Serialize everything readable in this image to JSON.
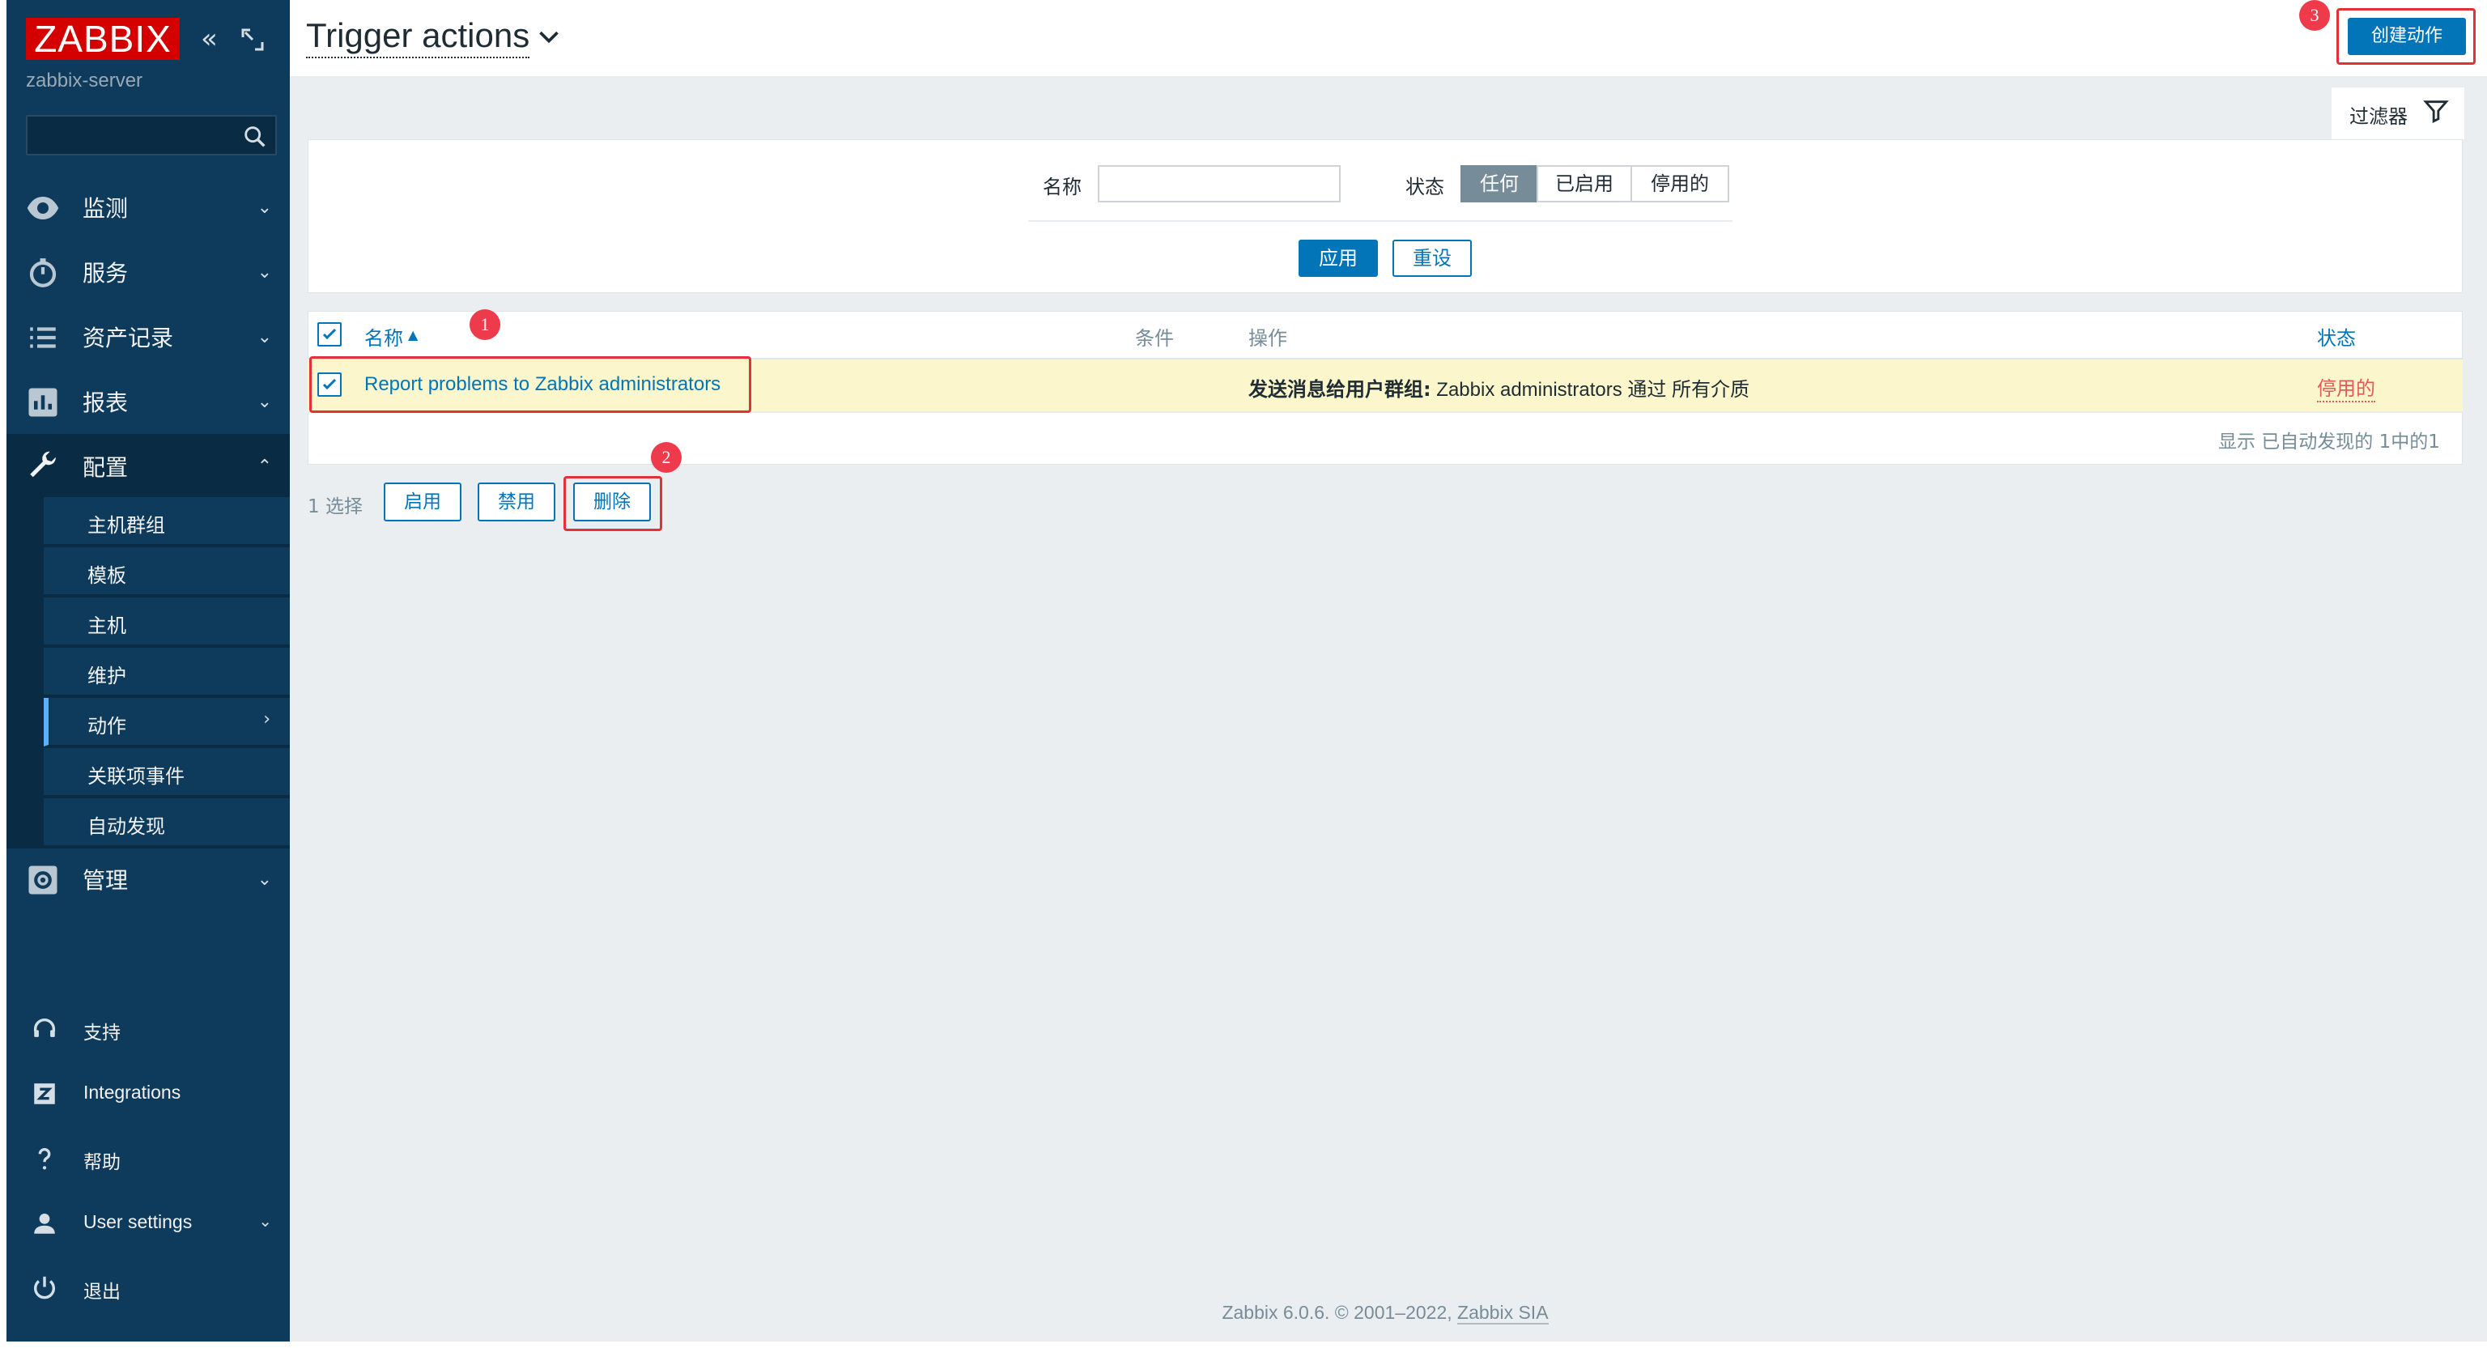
{
  "sidebar": {
    "logo": "ZABBIX",
    "server_name": "zabbix-server",
    "search_placeholder": "",
    "menu": [
      {
        "label": "监测",
        "icon": "eye-icon"
      },
      {
        "label": "服务",
        "icon": "stopwatch-icon"
      },
      {
        "label": "资产记录",
        "icon": "list-icon"
      },
      {
        "label": "报表",
        "icon": "bar-chart-icon"
      },
      {
        "label": "配置",
        "icon": "wrench-icon"
      },
      {
        "label": "管理",
        "icon": "gear-icon"
      }
    ],
    "config_submenu": [
      "主机群组",
      "模板",
      "主机",
      "维护",
      "动作",
      "关联项事件",
      "自动发现"
    ],
    "bottom": [
      {
        "label": "支持",
        "icon": "headset-icon"
      },
      {
        "label": "Integrations",
        "icon": "z-icon"
      },
      {
        "label": "帮助",
        "icon": "question-icon"
      },
      {
        "label": "User settings",
        "icon": "user-icon"
      },
      {
        "label": "退出",
        "icon": "power-icon"
      }
    ]
  },
  "header": {
    "title": "Trigger actions",
    "create_button": "创建动作"
  },
  "filter": {
    "tab_label": "过滤器",
    "name_label": "名称",
    "name_value": "",
    "status_label": "状态",
    "status_options": [
      "任何",
      "已启用",
      "停用的"
    ],
    "status_selected": "任何",
    "apply_button": "应用",
    "reset_button": "重设"
  },
  "table": {
    "columns": [
      "名称",
      "条件",
      "操作",
      "状态"
    ],
    "sort_indicator": "▲",
    "rows": [
      {
        "name": "Report problems to Zabbix administrators",
        "conditions": "",
        "operation_prefix": "发送消息给用户群组:",
        "operation_text": " Zabbix administrators 通过 所有介质",
        "status": "停用的",
        "checked": true
      }
    ],
    "stats": "显示 已自动发现的 1中的1"
  },
  "mass_actions": {
    "selected_count": "1 选择",
    "enable_button": "启用",
    "disable_button": "禁用",
    "delete_button": "删除"
  },
  "annotations": [
    "1",
    "2",
    "3"
  ],
  "footer": {
    "text": "Zabbix 6.0.6. © 2001–2022, ",
    "link": "Zabbix SIA"
  },
  "colors": {
    "sidebar_bg": "#0e3b5c",
    "brand_red": "#d40000",
    "primary_blue": "#0275b8",
    "row_highlight": "#fbf6cc",
    "status_red": "#e45959",
    "annotation_red": "#e3313a"
  }
}
